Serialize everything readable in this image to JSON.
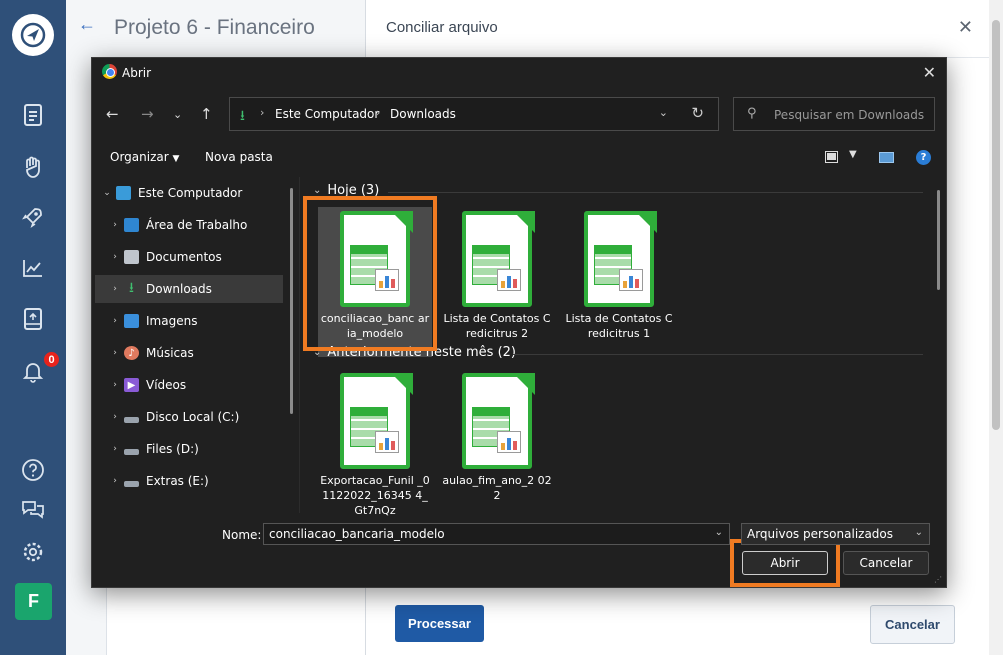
{
  "app": {
    "project_title": "Projeto 6 - Financeiro",
    "notification_count": "0",
    "avatar_letter": "F"
  },
  "panel": {
    "title": "Conciliar arquivo",
    "process_label": "Processar",
    "cancel_label": "Cancelar"
  },
  "dialog": {
    "title": "Abrir",
    "breadcrumb": [
      "Este Computador",
      "Downloads"
    ],
    "search_placeholder": "Pesquisar em Downloads",
    "toolbar": {
      "organize": "Organizar",
      "new_folder": "Nova pasta"
    },
    "tree": [
      {
        "label": "Este Computador",
        "icon": "computer-icon",
        "color": "#3a9bd9"
      },
      {
        "label": "Área de Trabalho",
        "icon": "desktop-icon",
        "color": "#2f86d1"
      },
      {
        "label": "Documentos",
        "icon": "documents-icon",
        "color": "#bfc5cc"
      },
      {
        "label": "Downloads",
        "icon": "downloads-icon",
        "color": "#3fbf6f"
      },
      {
        "label": "Imagens",
        "icon": "pictures-icon",
        "color": "#3a8fdc"
      },
      {
        "label": "Músicas",
        "icon": "music-icon",
        "color": "#e07a5f"
      },
      {
        "label": "Vídeos",
        "icon": "videos-icon",
        "color": "#8a5bd6"
      },
      {
        "label": "Disco Local (C:)",
        "icon": "drive-icon",
        "color": "#9aa3ad"
      },
      {
        "label": "Files (D:)",
        "icon": "drive-icon",
        "color": "#9aa3ad"
      },
      {
        "label": "Extras (E:)",
        "icon": "drive-icon",
        "color": "#9aa3ad"
      }
    ],
    "groups": [
      {
        "header": "Hoje (3)",
        "files": [
          "conciliacao_bancaria_modelo",
          "Lista de Contatos Credicitrus 2",
          "Lista de Contatos Credicitrus 1"
        ]
      },
      {
        "header": "Anteriormente neste mês (2)",
        "files": [
          "Exportacao_Funil_01122022_163454_Gt7nQz",
          "aulao_fim_ano_2022"
        ]
      }
    ],
    "file_display": [
      "conciliacao_banc aria_modelo",
      "Lista de Contatos Credicitrus 2",
      "Lista de Contatos Credicitrus 1",
      "Exportacao_Funil _01122022_16345 4_Gt7nQz",
      "aulao_fim_ano_2 022"
    ],
    "name_label": "Nome:",
    "name_value": "conciliacao_bancaria_modelo",
    "file_type": "Arquivos personalizados",
    "open_label": "Abrir",
    "cancel_label": "Cancelar"
  },
  "colors": {
    "rail": "#2f5079",
    "highlight": "#f07b22",
    "spreadsheet_green": "#2fae3a",
    "primary_button": "#1f5aa5"
  }
}
